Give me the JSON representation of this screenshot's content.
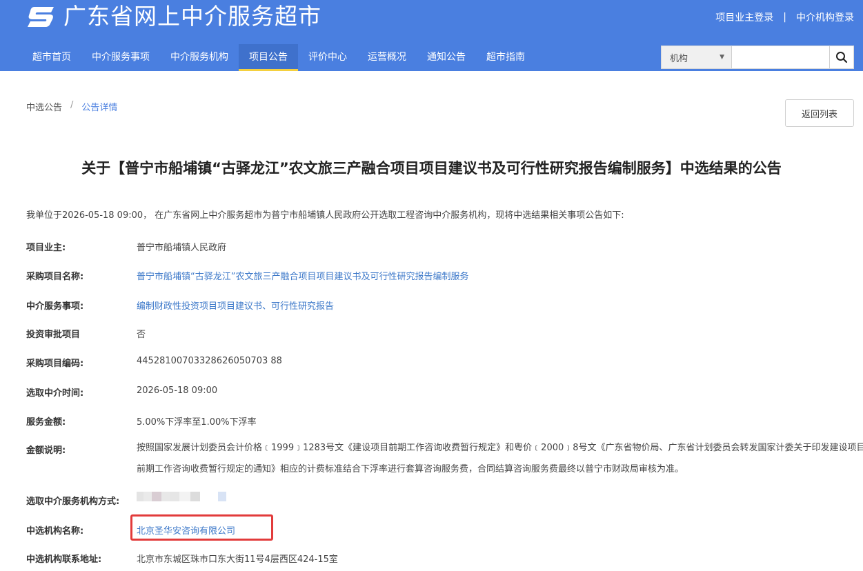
{
  "header": {
    "site_title": "广东省网上中介服务超市",
    "logo_icon": "s-logo-icon",
    "owner_login": "项目业主登录",
    "separator": "|",
    "agency_login": "中介机构登录"
  },
  "nav": {
    "items": [
      {
        "label": "超市首页",
        "active": false
      },
      {
        "label": "中介服务事项",
        "active": false
      },
      {
        "label": "中介服务机构",
        "active": false
      },
      {
        "label": "项目公告",
        "active": true
      },
      {
        "label": "评价中心",
        "active": false
      },
      {
        "label": "运营概况",
        "active": false
      },
      {
        "label": "通知公告",
        "active": false
      },
      {
        "label": "超市指南",
        "active": false
      }
    ]
  },
  "search": {
    "select_value": "机构",
    "input_value": "",
    "input_placeholder": ""
  },
  "breadcrumb": {
    "parent": "中选公告",
    "separator": "/",
    "current": "公告详情"
  },
  "back_button": "返回列表",
  "title": "关于【普宁市船埔镇“古驿龙江”农文旅三产融合项目项目建议书及可行性研究报告编制服务】中选结果的公告",
  "intro": "我单位于2026-05-18 09:00， 在广东省网上中介服务超市为普宁市船埔镇人民政府公开选取工程咨询中介服务机构，现将中选结果相关事项公告如下:",
  "fields": {
    "owner": {
      "label": "项目业主:",
      "value": "普宁市船埔镇人民政府"
    },
    "project_name": {
      "label": "采购项目名称:",
      "value": "普宁市船埔镇“古驿龙江”农文旅三产融合项目项目建议书及可行性研究报告编制服务"
    },
    "service_item": {
      "label": "中介服务事项:",
      "value": "编制财政性投资项目项目建议书、可行性研究报告"
    },
    "investment_approval": {
      "label": "投资审批项目",
      "value": "否"
    },
    "project_code": {
      "label": "采购项目编码:",
      "value": "44528100703328626050703 88"
    },
    "selection_time": {
      "label": "选取中介时间:",
      "value": "2026-05-18 09:00"
    },
    "service_amount": {
      "label": "服务金额:",
      "value": "5.00%下浮率至1.00%下浮率"
    },
    "amount_note": {
      "label": "金额说明:",
      "value": "按照国家发展计划委员会计价格﹝1999﹞1283号文《建设项目前期工作咨询收费暂行规定》和粤价﹝2000﹞8号文《广东省物价局、广东省计划委员会转发国家计委关于印发建设项目前期工作咨询收费暂行规定的通知》相应的计费标准结合下浮率进行套算咨询服务费，合同结算咨询服务费最终以普宁市财政局审核为准。"
    },
    "selection_method": {
      "label": "选取中介服务机构方式:",
      "value": ""
    },
    "agency_name": {
      "label": "中选机构名称:",
      "value": "北京圣华安咨询有限公司"
    },
    "agency_address": {
      "label": "中选机构联系地址:",
      "value": "北京市东城区珠市口东大街11号4层西区424-15室"
    }
  },
  "colors": {
    "header_bg": "#4a7fe0",
    "nav_active_underline": "#f4d03f",
    "link": "#3c78c9",
    "highlight": "#e23b3b"
  }
}
